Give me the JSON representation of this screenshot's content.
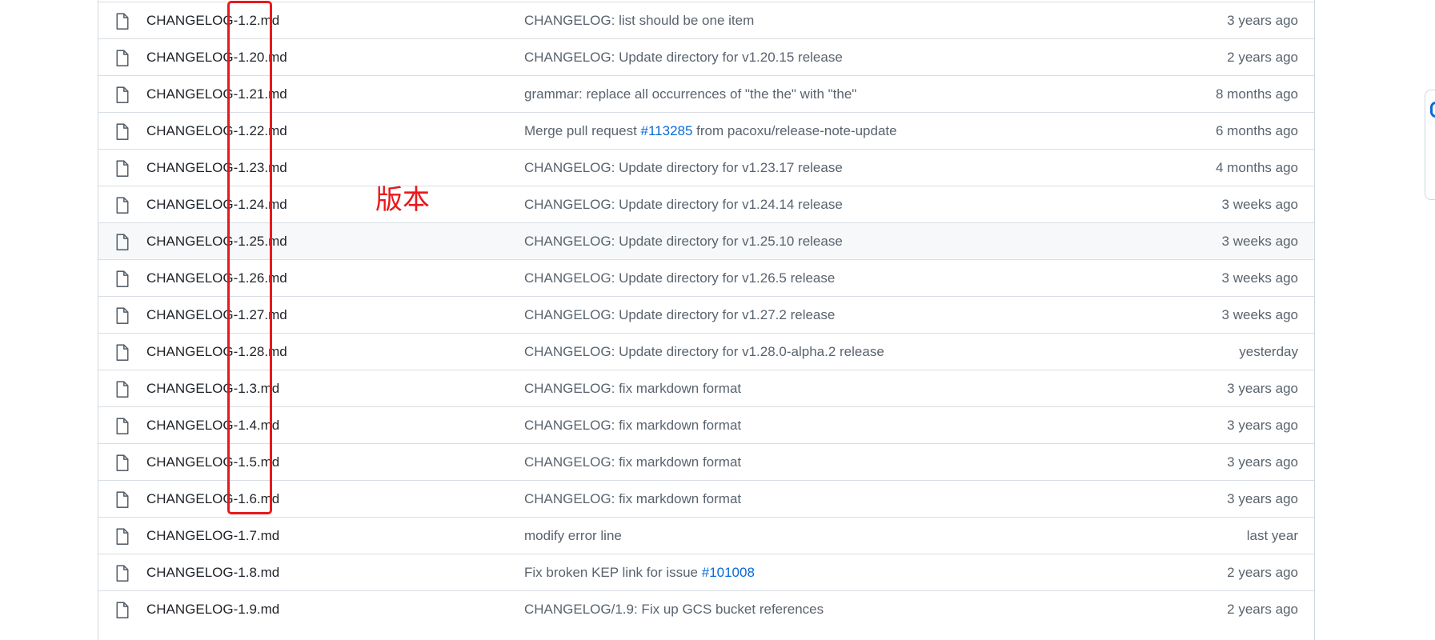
{
  "annotation": {
    "label": "版本",
    "color": "#e8191c"
  },
  "file_list": {
    "rows": [
      {
        "name": "CHANGELOG-1.2.md",
        "message": "CHANGELOG: list should be one item",
        "message_link": "",
        "message_suffix": "",
        "time": "3 years ago"
      },
      {
        "name": "CHANGELOG-1.20.md",
        "message": "CHANGELOG: Update directory for v1.20.15 release",
        "message_link": "",
        "message_suffix": "",
        "time": "2 years ago"
      },
      {
        "name": "CHANGELOG-1.21.md",
        "message": "grammar: replace all occurrences of \"the the\" with \"the\"",
        "message_link": "",
        "message_suffix": "",
        "time": "8 months ago"
      },
      {
        "name": "CHANGELOG-1.22.md",
        "message": "Merge pull request ",
        "message_link": "#113285",
        "message_suffix": " from pacoxu/release-note-update",
        "time": "6 months ago"
      },
      {
        "name": "CHANGELOG-1.23.md",
        "message": "CHANGELOG: Update directory for v1.23.17 release",
        "message_link": "",
        "message_suffix": "",
        "time": "4 months ago"
      },
      {
        "name": "CHANGELOG-1.24.md",
        "message": "CHANGELOG: Update directory for v1.24.14 release",
        "message_link": "",
        "message_suffix": "",
        "time": "3 weeks ago"
      },
      {
        "name": "CHANGELOG-1.25.md",
        "message": "CHANGELOG: Update directory for v1.25.10 release",
        "message_link": "",
        "message_suffix": "",
        "time": "3 weeks ago",
        "hovered": true
      },
      {
        "name": "CHANGELOG-1.26.md",
        "message": "CHANGELOG: Update directory for v1.26.5 release",
        "message_link": "",
        "message_suffix": "",
        "time": "3 weeks ago"
      },
      {
        "name": "CHANGELOG-1.27.md",
        "message": "CHANGELOG: Update directory for v1.27.2 release",
        "message_link": "",
        "message_suffix": "",
        "time": "3 weeks ago"
      },
      {
        "name": "CHANGELOG-1.28.md",
        "message": "CHANGELOG: Update directory for v1.28.0-alpha.2 release",
        "message_link": "",
        "message_suffix": "",
        "time": "yesterday"
      },
      {
        "name": "CHANGELOG-1.3.md",
        "message": "CHANGELOG: fix markdown format",
        "message_link": "",
        "message_suffix": "",
        "time": "3 years ago"
      },
      {
        "name": "CHANGELOG-1.4.md",
        "message": "CHANGELOG: fix markdown format",
        "message_link": "",
        "message_suffix": "",
        "time": "3 years ago"
      },
      {
        "name": "CHANGELOG-1.5.md",
        "message": "CHANGELOG: fix markdown format",
        "message_link": "",
        "message_suffix": "",
        "time": "3 years ago"
      },
      {
        "name": "CHANGELOG-1.6.md",
        "message": "CHANGELOG: fix markdown format",
        "message_link": "",
        "message_suffix": "",
        "time": "3 years ago"
      },
      {
        "name": "CHANGELOG-1.7.md",
        "message": "modify error line",
        "message_link": "",
        "message_suffix": "",
        "time": "last year"
      },
      {
        "name": "CHANGELOG-1.8.md",
        "message": "Fix broken KEP link for issue ",
        "message_link": "#101008",
        "message_suffix": "",
        "time": "2 years ago"
      },
      {
        "name": "CHANGELOG-1.9.md",
        "message": "CHANGELOG/1.9: Fix up GCS bucket references",
        "message_link": "",
        "message_suffix": "",
        "time": "2 years ago"
      }
    ]
  }
}
